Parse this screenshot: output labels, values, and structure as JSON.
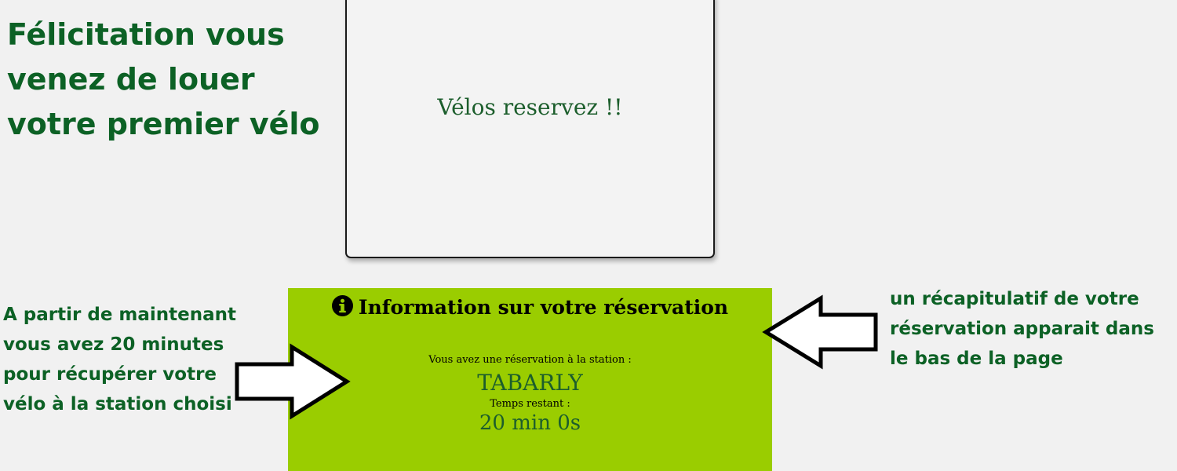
{
  "congrats": {
    "heading": "Félicitation vous venez de louer votre premier vélo"
  },
  "modal": {
    "message": "Vélos reservez !!"
  },
  "info_panel": {
    "title": "Information sur votre réservation",
    "icon": "info-circle-icon",
    "station_label": "Vous avez une réservation à la station :",
    "station_name": "TABARLY",
    "timer_label": "Temps restant :",
    "timer_value": "20 min 0s",
    "background_color": "#9acd00"
  },
  "annotations": {
    "left_note": "A partir de maintenant vous avez 20 minutes pour récupérer votre vélo à la station choisi",
    "right_note": "un récapitulatif de votre réservation apparait dans le bas de la page",
    "left_arrow_icon": "arrow-right-icon",
    "right_arrow_icon": "arrow-left-icon"
  },
  "colors": {
    "accent_green": "#0c6125",
    "text_green": "#1c5e2c",
    "page_background": "#f1f1f1"
  }
}
